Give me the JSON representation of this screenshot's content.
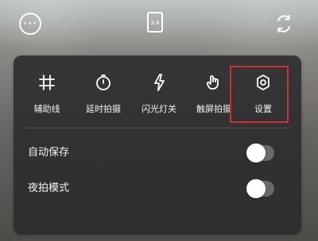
{
  "top_bar": {
    "more_icon": "more-icon",
    "ratio_label": "3:4",
    "flip_icon": "switch-camera-icon"
  },
  "tools": [
    {
      "label": "辅助线",
      "icon": "grid-icon"
    },
    {
      "label": "延时拍摄",
      "icon": "timer-icon"
    },
    {
      "label": "闪光灯关",
      "icon": "flash-off-icon"
    },
    {
      "label": "触屏拍摄",
      "icon": "touch-icon"
    },
    {
      "label": "设置",
      "icon": "settings-icon"
    }
  ],
  "toggles": [
    {
      "label": "自动保存",
      "state": "off"
    },
    {
      "label": "夜拍模式",
      "state": "off"
    }
  ],
  "colors": {
    "panel_bg": "#2a2a2c",
    "highlight_border": "#d32d32",
    "text": "#f2f2f2"
  }
}
